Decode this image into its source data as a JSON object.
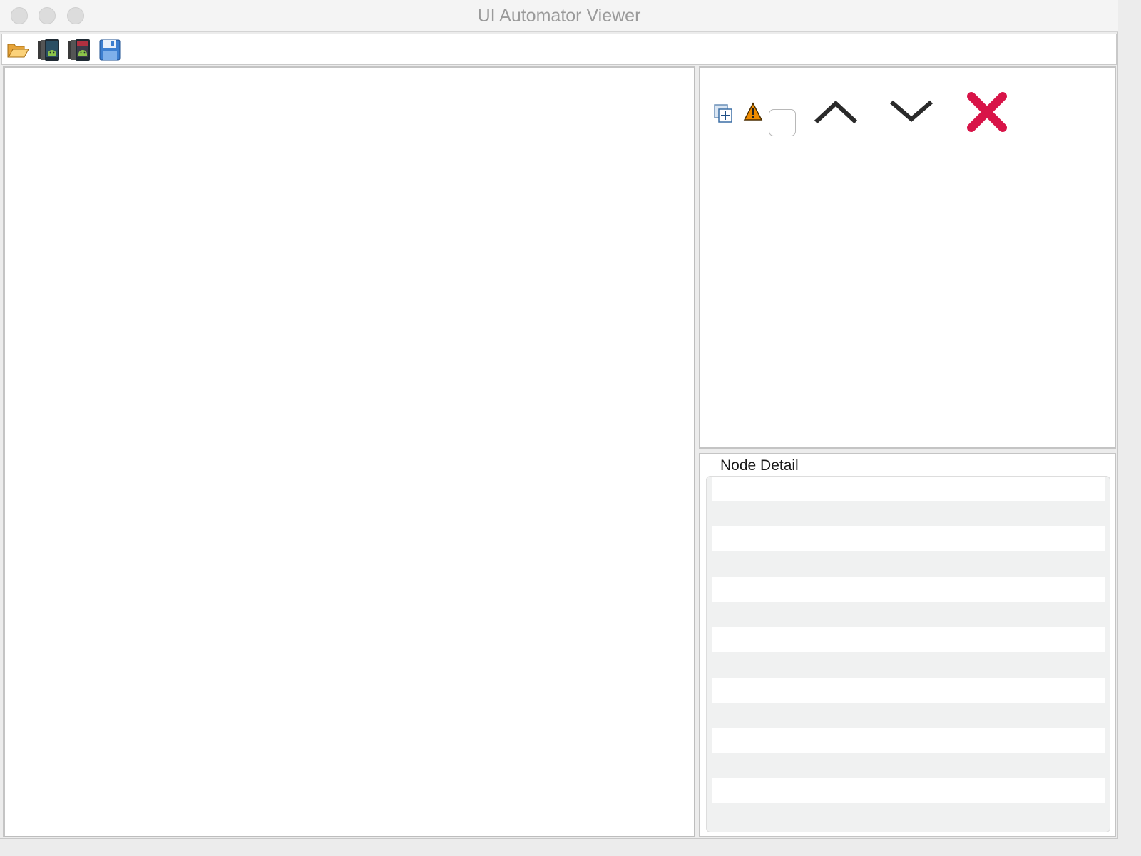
{
  "window": {
    "title": "UI Automator Viewer",
    "buttons": [
      "close",
      "minimize",
      "zoom"
    ]
  },
  "toolbar": {
    "buttons": [
      {
        "name": "open-icon",
        "tooltip": ""
      },
      {
        "name": "device-screenshot-icon",
        "tooltip": ""
      },
      {
        "name": "device-screenshot-compressed-icon",
        "tooltip": ""
      },
      {
        "name": "save-icon",
        "tooltip": ""
      }
    ]
  },
  "tree_panel": {
    "tools": [
      "expand-all-icon",
      "warning-icon",
      "filter-checkbox",
      "previous-arrow-icon",
      "next-arrow-icon",
      "clear-icon"
    ]
  },
  "detail_panel": {
    "title": "Node Detail",
    "rows": [
      "",
      "",
      "",
      "",
      "",
      "",
      ""
    ]
  },
  "colors": {
    "clear_red": "#d81448",
    "warning_orange": "#f08c00",
    "arrow_dark": "#2a2a2a",
    "save_blue": "#3c7fd0"
  }
}
